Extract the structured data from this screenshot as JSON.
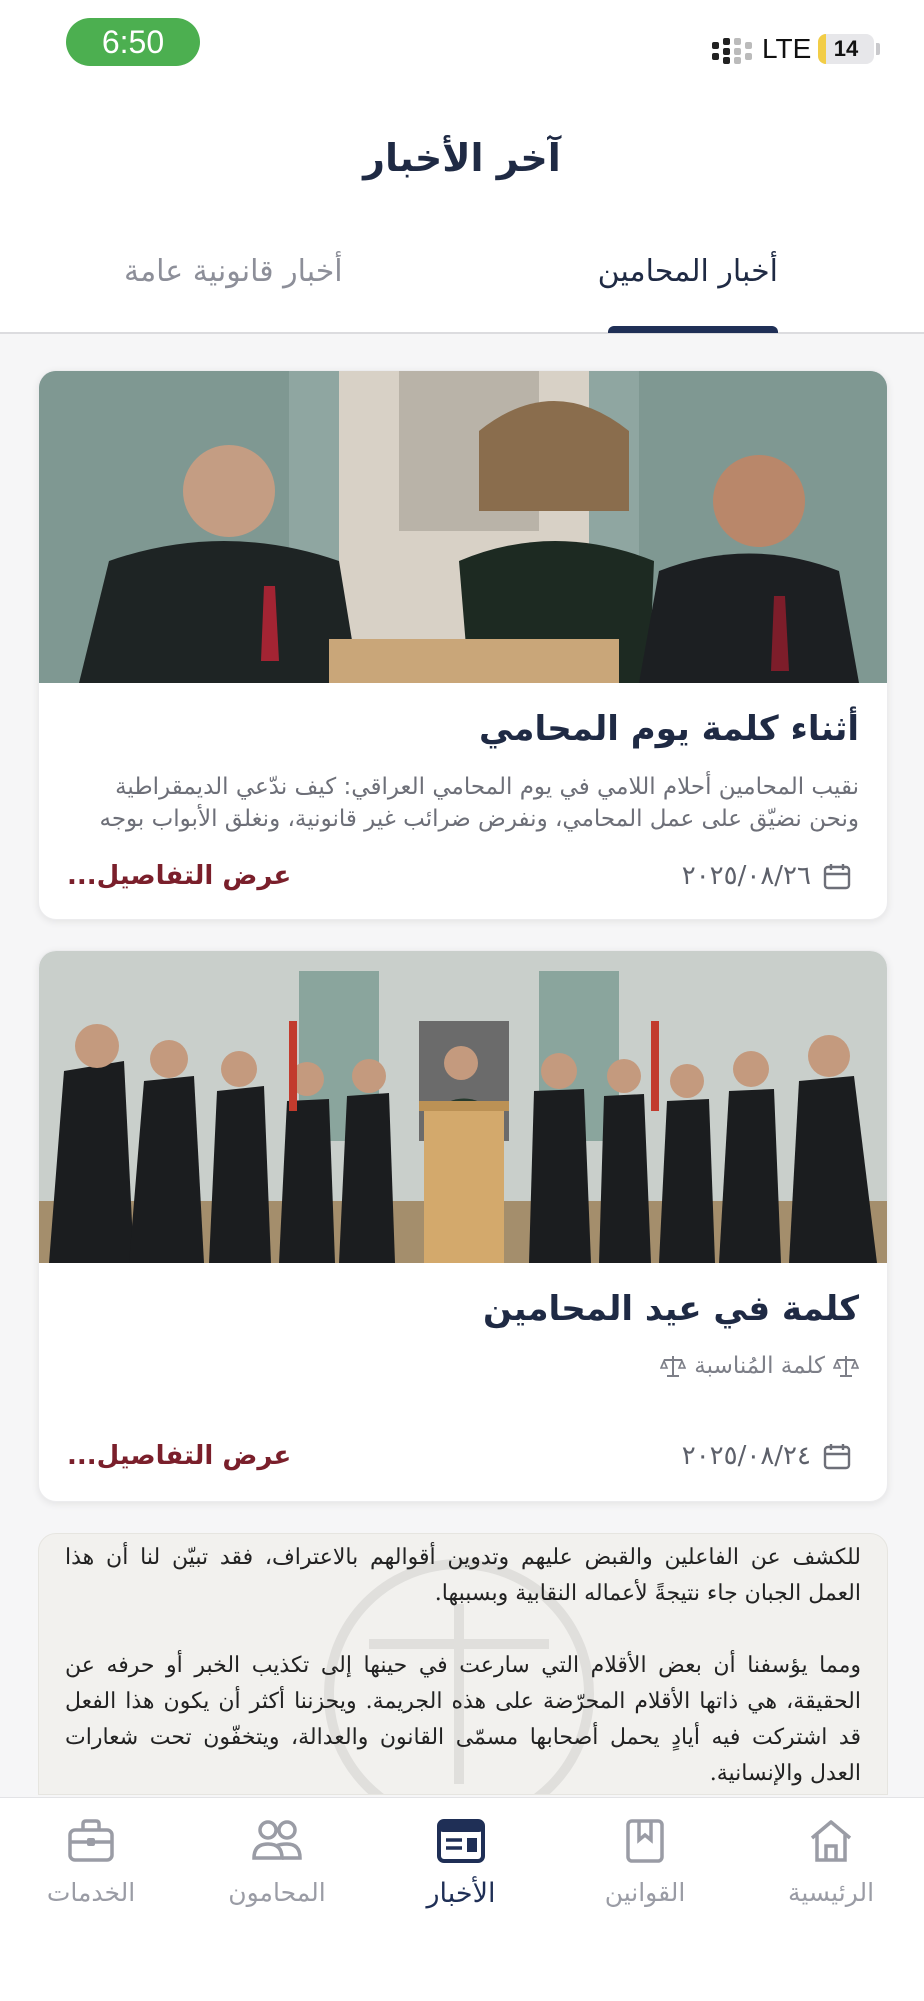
{
  "status_bar": {
    "time": "6:50",
    "network": "LTE",
    "battery": "14",
    "battery_level": 0.14,
    "time_pill_color": "#4caf50"
  },
  "header": {
    "title": "آخر الأخبار",
    "tabs": [
      {
        "label": "أخبار المحامين",
        "active": true
      },
      {
        "label": "أخبار قانونية عامة",
        "active": false
      }
    ]
  },
  "news": [
    {
      "title": "أثناء كلمة يوم المحامي",
      "excerpt": "نقيب المحامين أحلام اللامي في يوم المحامي العراقي: كيف ندّعي الديمقراطية ونحن نضيّق على عمل المحامي، ونفرض ضرائب غير قانونية، ونغلق الأبواب بوجه ا...",
      "date": "٢٠٢٥/٠٨/٢٦",
      "details_label": "عرض التفاصيل...",
      "image_icon": "lawyers-group-photo"
    },
    {
      "title": "كلمة في عيد المحامين",
      "category": "كلمة المُناسبة",
      "date": "٢٠٢٥/٠٨/٢٤",
      "details_label": "عرض التفاصيل...",
      "image_icon": "lawyers-ceremony-photo"
    }
  ],
  "document_preview": {
    "paragraph1": "للكشف عن الفاعلين والقبض عليهم وتدوين أقوالهم بالاعتراف، فقد تبيّن لنا أن هذا العمل الجبان جاء نتيجةً لأعماله النقابية وبسببها.",
    "paragraph2": "ومما يؤسفنا أن بعض الأقلام التي سارعت في حينها إلى تكذيب الخبر أو حرفه عن الحقيقة، هي ذاتها الأقلام المحرّضة على هذه الجريمة. ويحزننا أكثر أن يكون هذا الفعل قد اشتركت فيه أيادٍ يحمل أصحابها مسمّى القانون والعدالة، ويتخفّون تحت شعارات العدل والإنسانية."
  },
  "bottom_nav": [
    {
      "label": "الخدمات",
      "icon": "briefcase-icon"
    },
    {
      "label": "المحامون",
      "icon": "people-icon"
    },
    {
      "label": "الأخبار",
      "icon": "newspaper-icon",
      "active": true
    },
    {
      "label": "القوانين",
      "icon": "bookmark-book-icon"
    },
    {
      "label": "الرئيسية",
      "icon": "home-icon"
    }
  ],
  "colors": {
    "primary": "#1f2f56",
    "link": "#7a1f2b",
    "muted": "#9a9ca5"
  }
}
